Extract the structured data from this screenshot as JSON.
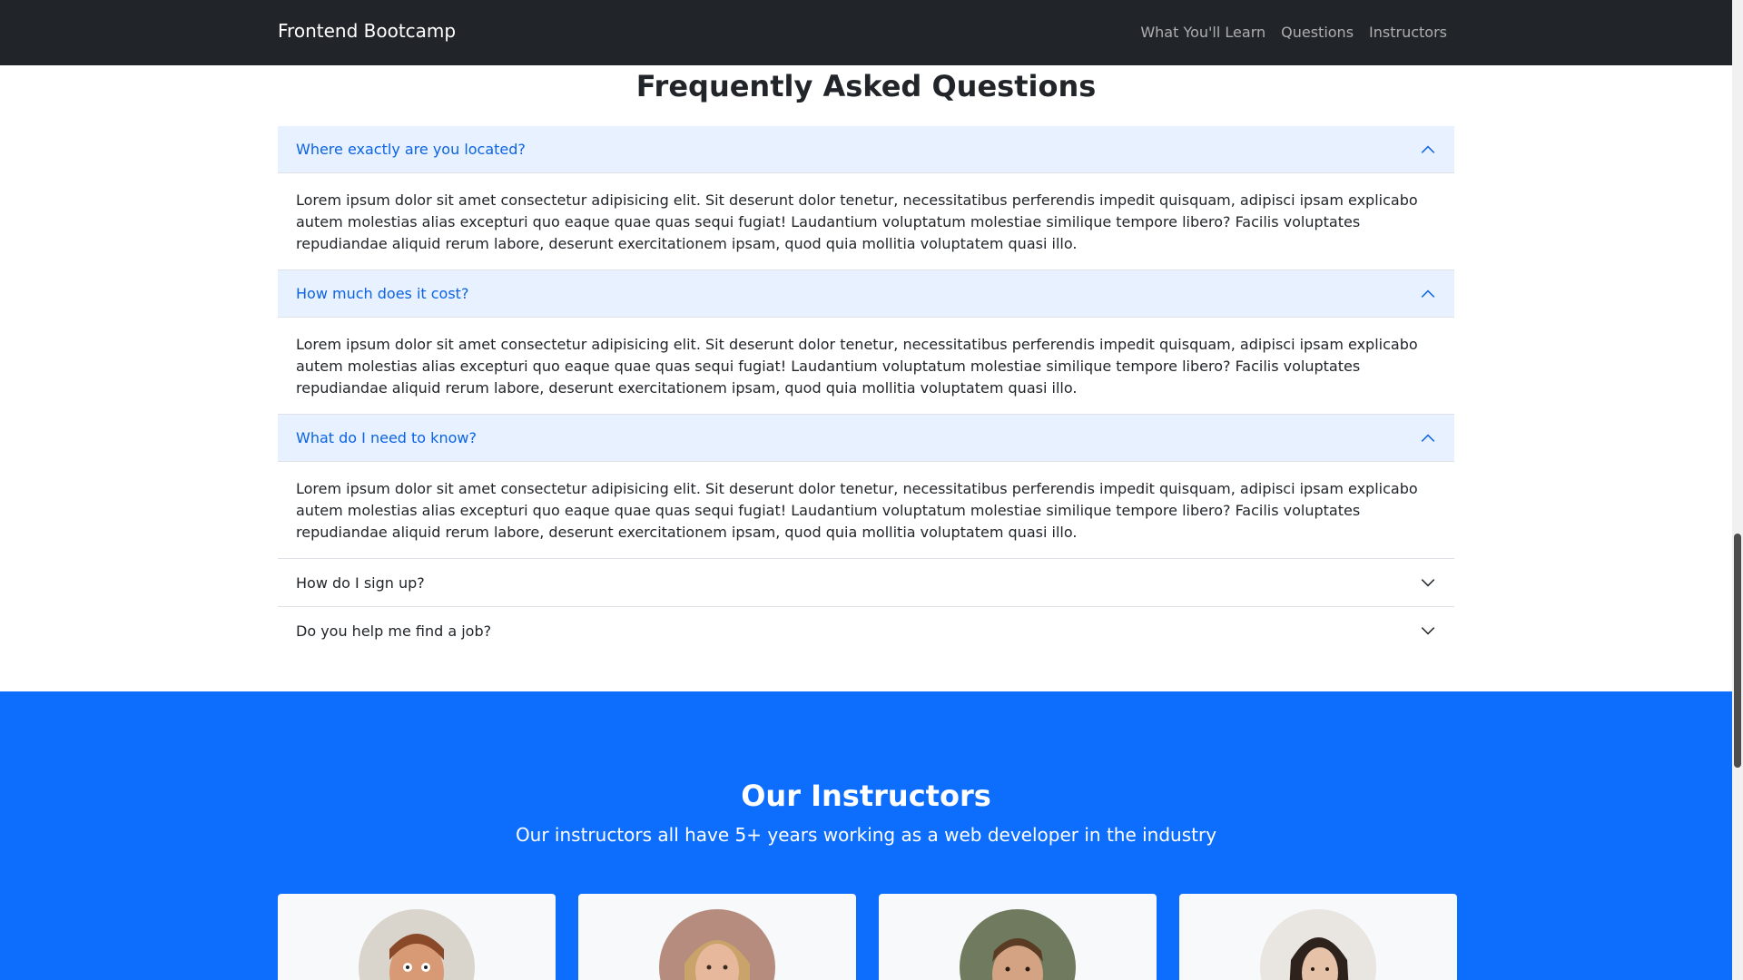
{
  "navbar": {
    "brand": "Frontend Bootcamp",
    "links": [
      "What You'll Learn",
      "Questions",
      "Instructors"
    ]
  },
  "faq": {
    "title": "Frequently Asked Questions",
    "items": [
      {
        "question": "Where exactly are you located?",
        "state": "open",
        "answer": "Lorem ipsum dolor sit amet consectetur adipisicing elit. Sit deserunt dolor tenetur, necessitatibus perferendis impedit quisquam, adipisci ipsam explicabo autem molestias alias excepturi quo eaque quae quas sequi fugiat! Laudantium voluptatum molestiae similique tempore libero? Facilis voluptates repudiandae aliquid rerum labore, deserunt exercitationem ipsam, quod quia mollitia voluptatem quasi illo."
      },
      {
        "question": "How much does it cost?",
        "state": "open",
        "answer": "Lorem ipsum dolor sit amet consectetur adipisicing elit. Sit deserunt dolor tenetur, necessitatibus perferendis impedit quisquam, adipisci ipsam explicabo autem molestias alias excepturi quo eaque quae quas sequi fugiat! Laudantium voluptatum molestiae similique tempore libero? Facilis voluptates repudiandae aliquid rerum labore, deserunt exercitationem ipsam, quod quia mollitia voluptatem quasi illo."
      },
      {
        "question": "What do I need to know?",
        "state": "open",
        "answer": "Lorem ipsum dolor sit amet consectetur adipisicing elit. Sit deserunt dolor tenetur, necessitatibus perferendis impedit quisquam, adipisci ipsam explicabo autem molestias alias excepturi quo eaque quae quas sequi fugiat! Laudantium voluptatum molestiae similique tempore libero? Facilis voluptates repudiandae aliquid rerum labore, deserunt exercitationem ipsam, quod quia mollitia voluptatem quasi illo."
      },
      {
        "question": "How do I sign up?",
        "state": "closed"
      },
      {
        "question": "Do you help me find a job?",
        "state": "closed"
      }
    ]
  },
  "instructors": {
    "title": "Our Instructors",
    "subtitle": "Our instructors all have 5+ years working as a web developer in the industry",
    "cards": [
      {
        "avatar_icon": "instructor-avatar-1"
      },
      {
        "avatar_icon": "instructor-avatar-2"
      },
      {
        "avatar_icon": "instructor-avatar-3"
      },
      {
        "avatar_icon": "instructor-avatar-4"
      }
    ]
  },
  "colors": {
    "navbar_bg": "#212529",
    "accent": "#0d6efd",
    "accordion_open_bg": "#e7f1ff",
    "accordion_open_text": "#0c63e4"
  }
}
